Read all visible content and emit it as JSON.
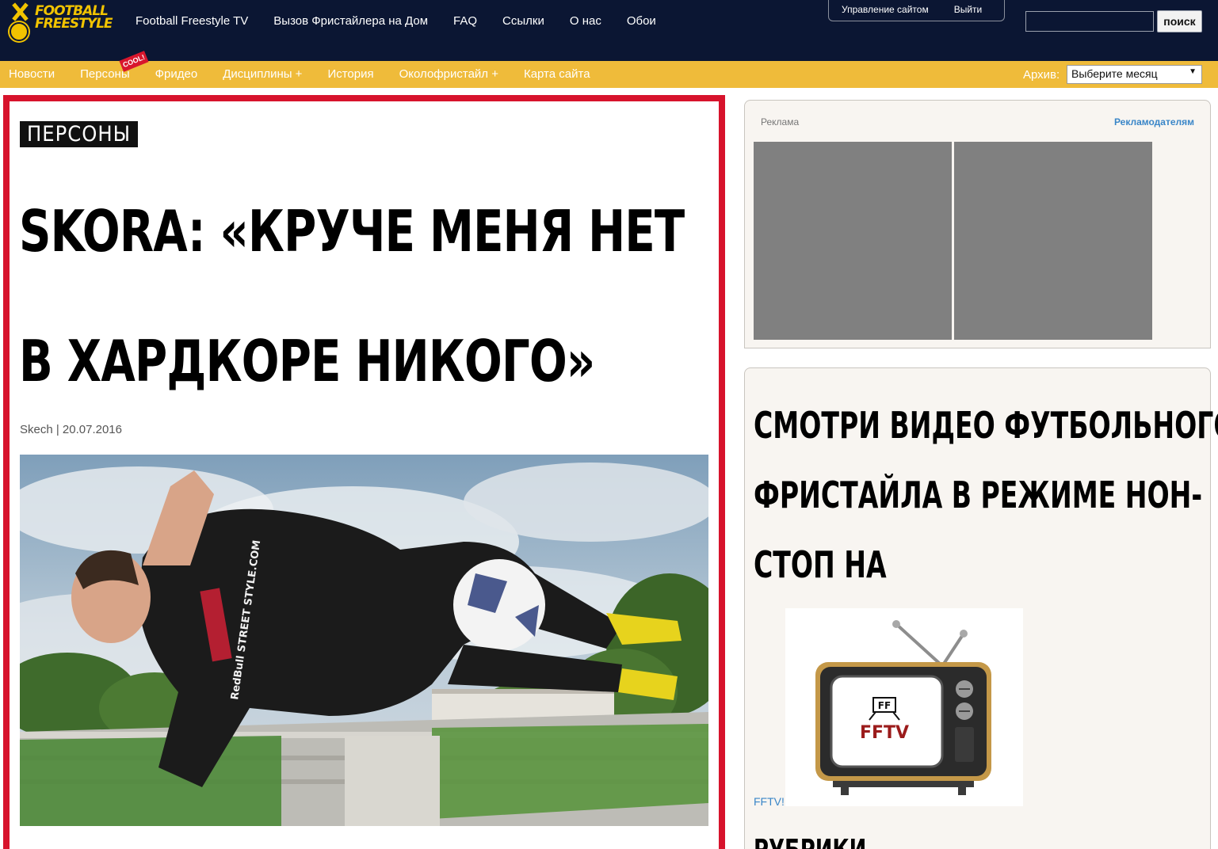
{
  "logo": {
    "line1": "FOOTBALL",
    "line2": "FREESTYLE"
  },
  "main_nav": [
    "Football Freestyle TV",
    "Вызов Фристайлера на Дом",
    "FAQ",
    "Ссылки",
    "О нас",
    "Обои"
  ],
  "admin": {
    "manage": "Управление сайтом",
    "logout": "Выйти"
  },
  "search": {
    "value": "",
    "button": "поиск"
  },
  "sub_nav": [
    "Новости",
    "Персоны",
    "Фридео",
    "Дисциплины +",
    "История",
    "Околофристайл +",
    "Карта сайта"
  ],
  "cool_badge": "COOL!",
  "archive": {
    "label": "Архив:",
    "selected": "Выберите месяц"
  },
  "article": {
    "category": "ПЕРСОНЫ",
    "title_line1": "SKORA: «КРУЧЕ МЕНЯ НЕТ",
    "title_line2": "В ХАРДКОРЕ НИКОГО»",
    "byline": "Skech | 20.07.2016",
    "shirt_text": "RedBull STREET STYLE.COM"
  },
  "ads": {
    "label": "Реклама",
    "advertisers_link": "Рекламодателям"
  },
  "fftv": {
    "title_line1": "СМОТРИ ВИДЕО ФУТБОЛЬНОГО",
    "title_line2": "ФРИСТАЙЛА В РЕЖИМЕ НОН-",
    "title_line3": "СТОП НА",
    "tv_logo": "FF",
    "tv_brand": "FFTV",
    "link": "FFTV!",
    "rubrics_heading": "РУБРИКИ"
  },
  "colors": {
    "topbar": "#0b1633",
    "subnav": "#efbb3a",
    "accent_red": "#d7132c",
    "link_blue": "#3a86c8",
    "logo_yellow": "#f1c300"
  }
}
